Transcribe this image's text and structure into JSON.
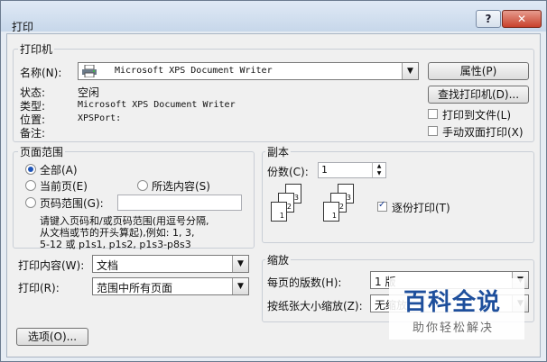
{
  "window": {
    "title": "打印",
    "help": "?",
    "close": "✕"
  },
  "printer": {
    "group_label": "打印机",
    "name_label": "名称(N):",
    "name_value": "Microsoft XPS Document Writer",
    "properties_button": "属性(P)",
    "find_button": "查找打印机(D)...",
    "status_label": "状态:",
    "status_value": "空闲",
    "type_label": "类型:",
    "type_value": "Microsoft XPS Document Writer",
    "location_label": "位置:",
    "location_value": "XPSPort:",
    "comment_label": "备注:",
    "print_to_file": "打印到文件(L)",
    "manual_duplex": "手动双面打印(X)"
  },
  "page_range": {
    "group_label": "页面范围",
    "all": "全部(A)",
    "current": "当前页(E)",
    "selection": "所选内容(S)",
    "pages": "页码范围(G):",
    "pages_value": "",
    "hint_line1": "请键入页码和/或页码范围(用逗号分隔,",
    "hint_line2": "从文档或节的开头算起),例如: 1, 3,",
    "hint_line3": "5-12 或 p1s1, p1s2, p1s3-p8s3"
  },
  "copies": {
    "group_label": "副本",
    "count_label": "份数(C):",
    "count_value": "1",
    "collate": "逐份打印(T)",
    "page_numbers": [
      "1",
      "2",
      "3"
    ]
  },
  "print_what": {
    "label": "打印内容(W):",
    "value": "文档"
  },
  "print_range": {
    "label": "打印(R):",
    "value": "范围中所有页面"
  },
  "zoom": {
    "group_label": "缩放",
    "pages_per_sheet_label": "每页的版数(H):",
    "pages_per_sheet_value": "1 版",
    "scale_label": "按纸张大小缩放(Z):",
    "scale_value": "无缩放"
  },
  "options_button": "选项(O)...",
  "watermark": {
    "title": "百科全说",
    "subtitle": "助你轻松解决"
  }
}
